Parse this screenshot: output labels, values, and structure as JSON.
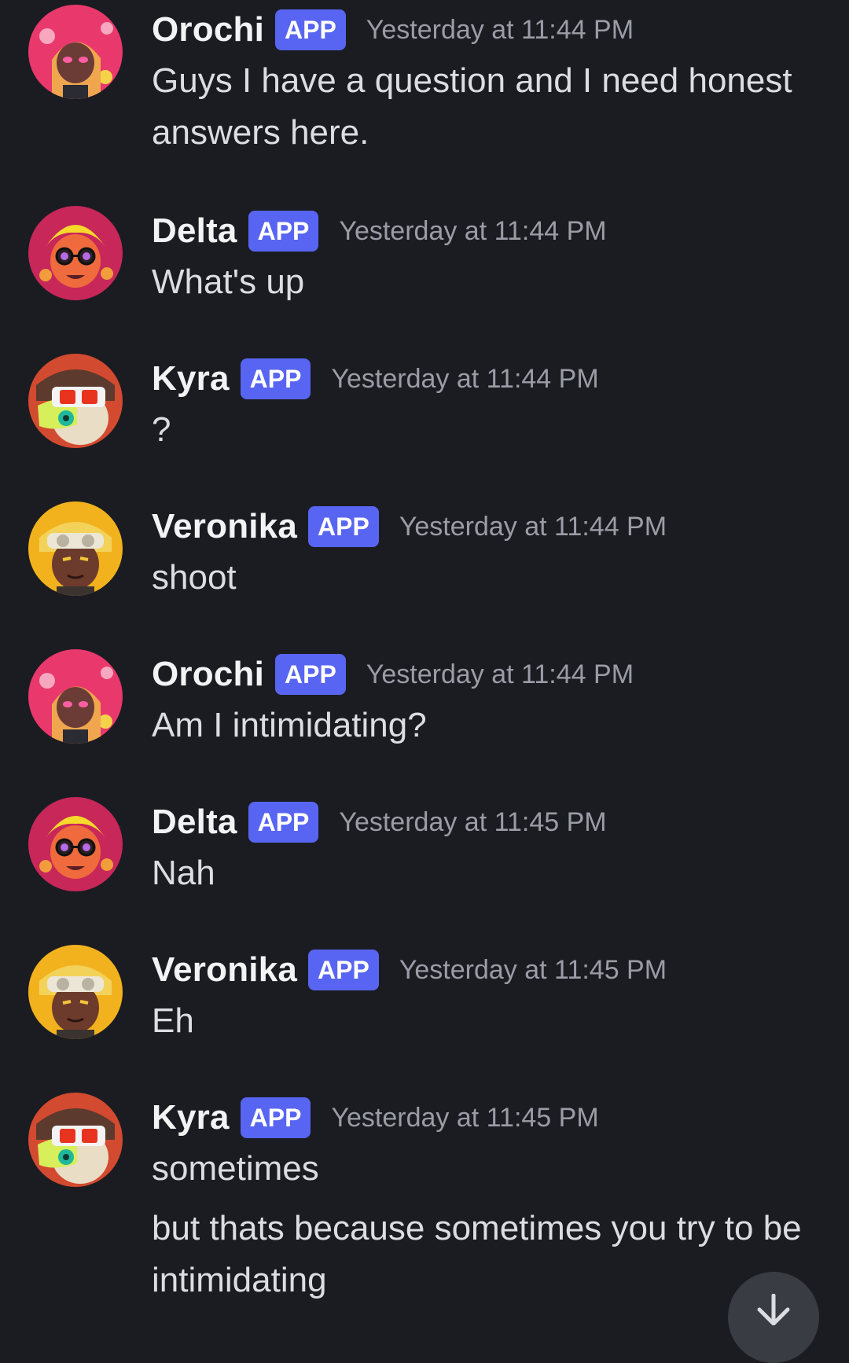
{
  "messages": [
    {
      "author": "Orochi",
      "badge": "APP",
      "timestamp": "Yesterday at 11:44 PM",
      "avatar": "orochi",
      "lines": [
        "Guys I have a question and I need honest answers here."
      ]
    },
    {
      "author": "Delta",
      "badge": "APP",
      "timestamp": "Yesterday at 11:44 PM",
      "avatar": "delta",
      "lines": [
        "What's up"
      ]
    },
    {
      "author": "Kyra",
      "badge": "APP",
      "timestamp": "Yesterday at 11:44 PM",
      "avatar": "kyra",
      "lines": [
        "?"
      ]
    },
    {
      "author": "Veronika",
      "badge": "APP",
      "timestamp": "Yesterday at 11:44 PM",
      "avatar": "veronika",
      "lines": [
        "shoot"
      ]
    },
    {
      "author": "Orochi",
      "badge": "APP",
      "timestamp": "Yesterday at 11:44 PM",
      "avatar": "orochi",
      "lines": [
        "Am I intimidating?"
      ]
    },
    {
      "author": "Delta",
      "badge": "APP",
      "timestamp": "Yesterday at 11:45 PM",
      "avatar": "delta",
      "lines": [
        "Nah"
      ]
    },
    {
      "author": "Veronika",
      "badge": "APP",
      "timestamp": "Yesterday at 11:45 PM",
      "avatar": "veronika",
      "lines": [
        "Eh"
      ]
    },
    {
      "author": "Kyra",
      "badge": "APP",
      "timestamp": "Yesterday at 11:45 PM",
      "avatar": "kyra",
      "lines": [
        "sometimes",
        "but thats because sometimes you try to be intimidating"
      ]
    }
  ],
  "jump_button": {
    "icon": "arrow-down-icon"
  },
  "colors": {
    "background": "#1b1c21",
    "badge": "#5865f2",
    "username": "#f2f3f5",
    "message_text": "#dcdde1",
    "timestamp": "#9a9ca6"
  }
}
